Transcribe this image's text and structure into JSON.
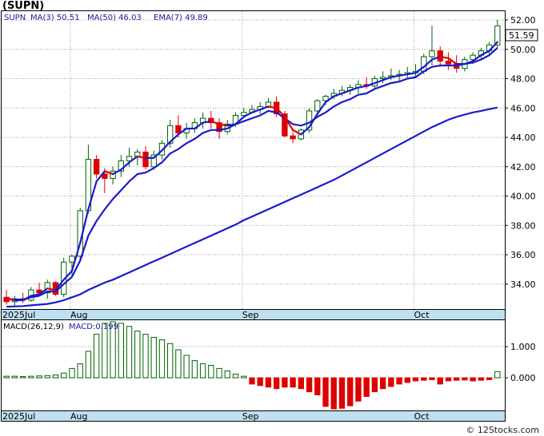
{
  "header": {
    "ticker": "(SUPN)"
  },
  "watermark": "© 12Stocks.com",
  "colors": {
    "up": "#006400",
    "down": "#dd0000",
    "ma": "#1a1acc",
    "ema": "#dd0000",
    "band": "#bfe0ef"
  },
  "chart_data": [
    {
      "type": "candlestick",
      "title": "(SUPN)",
      "legend": {
        "symbol": "SUPN",
        "items": [
          {
            "label": "MA(3)",
            "value": "50.51"
          },
          {
            "label": "MA(50)",
            "value": "46.03"
          },
          {
            "label": "EMA(7)",
            "value": "49.89"
          }
        ]
      },
      "last_price_label": "51.59",
      "y_ticks": [
        "34.00",
        "36.00",
        "38.00",
        "40.00",
        "42.00",
        "44.00",
        "46.00",
        "48.00",
        "50.00",
        "52.00"
      ],
      "ylim": [
        32.3,
        52.6
      ],
      "x_labels": [
        {
          "label": "2025Jul",
          "index": 0
        },
        {
          "label": "Aug",
          "index": 8
        },
        {
          "label": "Sep",
          "index": 29
        },
        {
          "label": "Oct",
          "index": 50
        }
      ],
      "candles": [
        [
          33.1,
          33.6,
          32.6,
          32.8
        ],
        [
          32.8,
          33.2,
          32.5,
          33.0
        ],
        [
          33.0,
          33.4,
          32.7,
          32.9
        ],
        [
          32.9,
          33.8,
          32.8,
          33.6
        ],
        [
          33.6,
          34.1,
          33.2,
          33.4
        ],
        [
          33.4,
          34.3,
          33.0,
          34.1
        ],
        [
          34.1,
          34.2,
          33.2,
          33.3
        ],
        [
          33.3,
          35.8,
          33.1,
          35.5
        ],
        [
          35.5,
          36.0,
          34.6,
          35.9
        ],
        [
          35.9,
          39.2,
          35.7,
          39.0
        ],
        [
          39.0,
          43.5,
          38.8,
          42.5
        ],
        [
          42.5,
          42.8,
          41.2,
          41.5
        ],
        [
          41.5,
          41.9,
          40.2,
          41.2
        ],
        [
          41.2,
          42.0,
          40.8,
          41.7
        ],
        [
          41.7,
          42.8,
          41.3,
          42.4
        ],
        [
          42.4,
          43.3,
          42.0,
          42.7
        ],
        [
          42.7,
          43.2,
          42.1,
          43.0
        ],
        [
          43.0,
          43.4,
          41.8,
          42.0
        ],
        [
          42.0,
          43.1,
          41.8,
          42.8
        ],
        [
          42.8,
          43.8,
          42.5,
          43.6
        ],
        [
          43.6,
          45.2,
          43.3,
          44.8
        ],
        [
          44.8,
          45.5,
          44.0,
          44.3
        ],
        [
          44.3,
          45.0,
          43.9,
          44.6
        ],
        [
          44.6,
          45.3,
          44.3,
          45.0
        ],
        [
          45.0,
          45.7,
          44.6,
          45.3
        ],
        [
          45.3,
          45.8,
          44.6,
          45.0
        ],
        [
          45.0,
          45.3,
          43.9,
          44.4
        ],
        [
          44.4,
          45.2,
          44.2,
          44.9
        ],
        [
          44.9,
          45.7,
          44.7,
          45.5
        ],
        [
          45.5,
          46.0,
          45.3,
          45.7
        ],
        [
          45.7,
          46.2,
          45.6,
          45.9
        ],
        [
          45.9,
          46.4,
          45.6,
          46.1
        ],
        [
          46.1,
          46.7,
          46.0,
          46.4
        ],
        [
          46.4,
          46.8,
          45.4,
          45.6
        ],
        [
          45.6,
          45.8,
          44.0,
          44.1
        ],
        [
          44.1,
          44.4,
          43.6,
          43.9
        ],
        [
          43.9,
          44.6,
          43.8,
          44.5
        ],
        [
          44.5,
          46.0,
          44.3,
          45.8
        ],
        [
          45.8,
          46.6,
          45.6,
          46.5
        ],
        [
          46.5,
          46.9,
          46.2,
          46.8
        ],
        [
          46.8,
          47.3,
          46.6,
          47.0
        ],
        [
          47.0,
          47.5,
          46.8,
          47.2
        ],
        [
          47.2,
          47.6,
          46.9,
          47.4
        ],
        [
          47.4,
          47.9,
          47.0,
          47.6
        ],
        [
          47.6,
          48.1,
          47.3,
          47.5
        ],
        [
          47.5,
          48.2,
          47.3,
          48.0
        ],
        [
          48.0,
          48.5,
          47.7,
          48.1
        ],
        [
          48.1,
          48.7,
          47.9,
          48.2
        ],
        [
          48.2,
          48.6,
          47.8,
          48.3
        ],
        [
          48.3,
          48.8,
          48.0,
          48.4
        ],
        [
          48.4,
          49.0,
          48.1,
          48.5
        ],
        [
          48.5,
          49.7,
          48.3,
          49.5
        ],
        [
          49.5,
          51.6,
          48.9,
          49.9
        ],
        [
          49.9,
          50.2,
          48.8,
          49.2
        ],
        [
          49.2,
          49.8,
          48.6,
          49.0
        ],
        [
          49.0,
          49.6,
          48.4,
          48.7
        ],
        [
          48.7,
          49.5,
          48.5,
          49.3
        ],
        [
          49.3,
          49.8,
          49.0,
          49.6
        ],
        [
          49.6,
          50.1,
          49.3,
          49.9
        ],
        [
          49.9,
          50.5,
          49.6,
          50.3
        ],
        [
          50.3,
          52.0,
          50.1,
          51.6
        ]
      ],
      "ma3": [
        33.0,
        32.9,
        32.9,
        33.2,
        33.3,
        33.7,
        33.6,
        34.3,
        34.9,
        36.8,
        39.1,
        41.0,
        41.7,
        41.5,
        41.8,
        42.3,
        42.7,
        42.6,
        42.6,
        43.1,
        43.7,
        44.2,
        44.6,
        44.6,
        45.0,
        45.1,
        44.9,
        44.8,
        44.9,
        45.4,
        45.7,
        45.9,
        46.1,
        46.0,
        45.4,
        44.5,
        44.2,
        44.7,
        45.6,
        46.4,
        46.8,
        47.0,
        47.2,
        47.4,
        47.5,
        47.7,
        47.9,
        48.1,
        48.2,
        48.3,
        48.4,
        48.8,
        49.3,
        49.5,
        49.4,
        49.0,
        49.0,
        49.2,
        49.6,
        49.9,
        50.5
      ],
      "ema7": [
        33.0,
        32.95,
        32.95,
        33.1,
        33.2,
        33.5,
        33.5,
        34.0,
        34.5,
        35.6,
        37.3,
        38.3,
        39.1,
        39.8,
        40.4,
        41.0,
        41.5,
        41.6,
        41.9,
        42.3,
        42.9,
        43.2,
        43.6,
        43.9,
        44.3,
        44.5,
        44.5,
        44.6,
        44.9,
        45.1,
        45.3,
        45.5,
        45.8,
        45.7,
        45.3,
        44.9,
        44.8,
        45.0,
        45.4,
        45.7,
        46.1,
        46.4,
        46.6,
        46.9,
        47.0,
        47.3,
        47.5,
        47.7,
        47.8,
        48.0,
        48.1,
        48.5,
        48.8,
        48.9,
        48.9,
        48.9,
        49.0,
        49.1,
        49.3,
        49.6,
        50.1
      ],
      "ma50": [
        32.45,
        32.48,
        32.5,
        32.55,
        32.6,
        32.65,
        32.75,
        32.9,
        33.1,
        33.3,
        33.6,
        33.85,
        34.1,
        34.3,
        34.55,
        34.8,
        35.05,
        35.3,
        35.55,
        35.8,
        36.05,
        36.3,
        36.55,
        36.8,
        37.05,
        37.3,
        37.55,
        37.8,
        38.05,
        38.35,
        38.6,
        38.85,
        39.1,
        39.35,
        39.6,
        39.85,
        40.1,
        40.35,
        40.6,
        40.85,
        41.1,
        41.4,
        41.7,
        42.0,
        42.3,
        42.6,
        42.9,
        43.2,
        43.5,
        43.8,
        44.1,
        44.4,
        44.7,
        44.95,
        45.2,
        45.4,
        45.55,
        45.7,
        45.8,
        45.92,
        46.03
      ]
    },
    {
      "type": "bar",
      "title": "MACD(26,12,9)",
      "legend": {
        "label": "MACD",
        "value": "0.199"
      },
      "y_ticks": [
        "1.000",
        "0.000"
      ],
      "ylim": [
        -1.05,
        1.85
      ],
      "values": [
        0.05,
        0.05,
        0.04,
        0.05,
        0.06,
        0.07,
        0.09,
        0.15,
        0.3,
        0.45,
        0.85,
        1.4,
        1.75,
        1.8,
        1.75,
        1.65,
        1.5,
        1.4,
        1.3,
        1.22,
        1.1,
        0.9,
        0.72,
        0.55,
        0.45,
        0.4,
        0.3,
        0.22,
        0.12,
        0.05,
        -0.2,
        -0.25,
        -0.3,
        -0.35,
        -0.3,
        -0.3,
        -0.35,
        -0.45,
        -0.55,
        -0.92,
        -1.0,
        -0.98,
        -0.9,
        -0.75,
        -0.6,
        -0.45,
        -0.35,
        -0.28,
        -0.2,
        -0.15,
        -0.1,
        -0.08,
        -0.06,
        -0.2,
        -0.1,
        -0.08,
        -0.07,
        -0.1,
        -0.08,
        -0.06,
        0.2
      ]
    }
  ]
}
